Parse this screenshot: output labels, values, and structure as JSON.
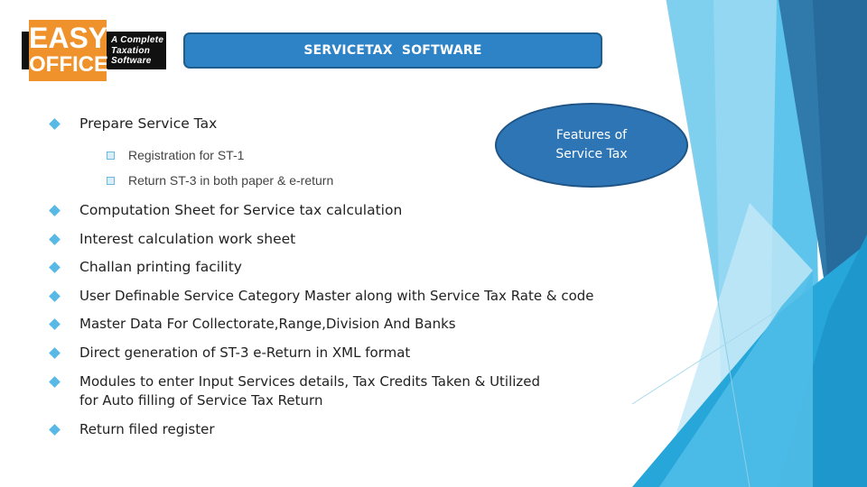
{
  "logo": {
    "line1": "EASY",
    "line2": "OFFICE",
    "tagline": [
      "A Complete",
      "Taxation",
      "Software"
    ]
  },
  "header": {
    "title": "SERVICETAX  SOFTWARE"
  },
  "callout": {
    "line1": "Features of",
    "line2": "Service Tax"
  },
  "features": {
    "main": "Prepare Service Tax",
    "sub_items": [
      "Registration for ST-1",
      "Return ST-3 in both paper & e-return"
    ],
    "items": [
      "Computation Sheet for Service tax calculation",
      "Interest calculation work sheet",
      "Challan printing facility",
      "User Definable Service Category Master along with Service Tax Rate & code",
      "Master Data For Collectorate,Range,Division And Banks",
      "Direct generation of ST-3 e-Return in XML format",
      "Modules to enter Input Services details, Tax Credits Taken & Utilized",
      "Return filed register"
    ],
    "item_7_line2": "for Auto filling of Service Tax Return"
  },
  "theme": {
    "accent": "#2e83c6",
    "bullet": "#58b9e6",
    "logo_orange": "#f0922b"
  }
}
